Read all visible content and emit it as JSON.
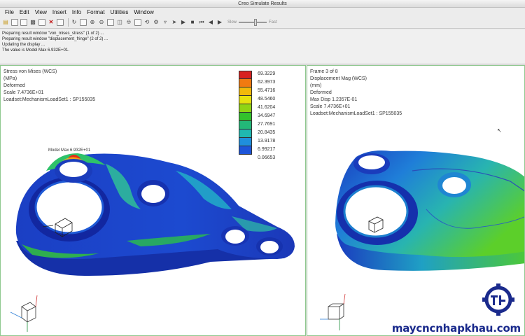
{
  "window": {
    "title": "Creo Simulate Results"
  },
  "menu": [
    "File",
    "Edit",
    "View",
    "Insert",
    "Info",
    "Format",
    "Utilities",
    "Window"
  ],
  "toolbar": {
    "slow_label": "Slow",
    "fast_label": "Fast"
  },
  "messages": [
    "Preparing result window \"von_mises_stress\" (1 of 2) ...",
    "Preparing result window \"displacement_fringe\" (2 of 2) ...",
    "Updating the display ...",
    "The value is Model Max  6.932E+01."
  ],
  "left_view": {
    "lines": [
      "Stress von Mises (WCS)",
      "(MPa)",
      "Deformed",
      "Scale  7.4736E+01",
      "Loadset:MechanismLoadSet1 :  SP155035"
    ],
    "legend": {
      "values": [
        "69.3229",
        "62.3973",
        "55.4716",
        "48.5460",
        "41.6204",
        "34.6947",
        "27.7691",
        "20.8435",
        "13.9178",
        "6.99217",
        "0.06653"
      ],
      "colors": [
        "#d82020",
        "#f07a10",
        "#f2b90a",
        "#e6e20e",
        "#8fd414",
        "#33c22c",
        "#23b878",
        "#20b8b0",
        "#1f8fdc",
        "#1d55d8"
      ]
    },
    "marker_label": "Model Max 6.932E+01"
  },
  "right_view": {
    "lines": [
      "Frame 3 of 8",
      "Displacement Mag (WCS)",
      "(mm)",
      "Deformed",
      "Max Disp  1.2357E-01",
      "Scale  7.4736E+01",
      "Loadset:MechanismLoadSet1 :  SP155035"
    ]
  },
  "watermark": {
    "text": "maycncnhapkhau.com"
  }
}
